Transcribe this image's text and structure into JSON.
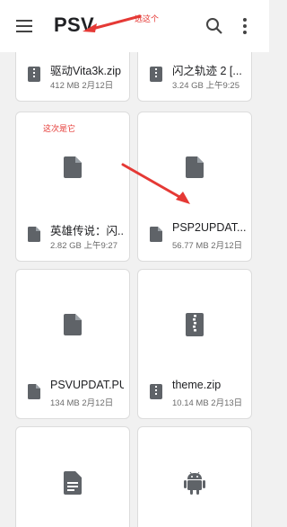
{
  "app_bar": {
    "title": "PSV",
    "menu_icon": "hamburger-menu-icon",
    "search_icon": "search-icon",
    "more_icon": "more-vert-icon"
  },
  "annotations": {
    "top_label": "选这个",
    "card_label": "这次是它",
    "color": "#e53935"
  },
  "files": [
    {
      "name": "驱动Vita3k.zip",
      "meta": "412 MB 2月12日",
      "type": "zip"
    },
    {
      "name": "闪之轨迹 2 [...",
      "meta": "3.24 GB 上午9:25",
      "type": "zip"
    },
    {
      "name": "英雄传说：闪...",
      "meta": "2.82 GB 上午9:27",
      "type": "file"
    },
    {
      "name": "PSP2UPDAT....",
      "meta": "56.77 MB 2月12日",
      "type": "file"
    },
    {
      "name": "PSVUPDAT.PUP",
      "meta": "134 MB 2月12日",
      "type": "file"
    },
    {
      "name": "theme.zip",
      "meta": "10.14 MB 2月13日",
      "type": "zip"
    },
    {
      "name": "",
      "meta": "",
      "type": "document"
    },
    {
      "name": "",
      "meta": "",
      "type": "android"
    }
  ]
}
